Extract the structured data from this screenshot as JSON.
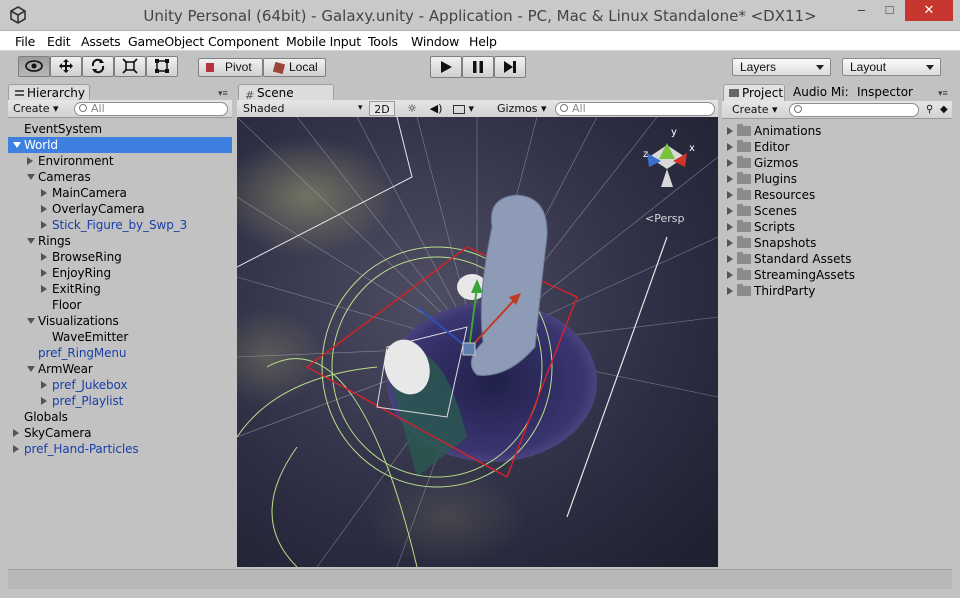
{
  "window": {
    "title": "Unity Personal (64bit) - Galaxy.unity - Application - PC, Mac & Linux Standalone* <DX11>",
    "minimize": "–",
    "maximize": "□",
    "close": "✕",
    "close_color": "#c7372f"
  },
  "menu": [
    "File",
    "Edit",
    "Assets",
    "GameObject",
    "Component",
    "Mobile Input",
    "Tools",
    "Window",
    "Help"
  ],
  "toolbar": {
    "tools": [
      "eye-icon",
      "move-icon",
      "rotate-icon",
      "scale-icon",
      "rect-icon"
    ],
    "pivot_label": "Pivot",
    "local_label": "Local",
    "layers_label": "Layers",
    "layout_label": "Layout"
  },
  "hierarchy": {
    "tab": "Hierarchy",
    "create": "Create",
    "search_placeholder": "All",
    "items": [
      {
        "label": "EventSystem",
        "depth": 0,
        "arrow": "none",
        "prefab": false
      },
      {
        "label": "World",
        "depth": 0,
        "arrow": "open",
        "prefab": false,
        "selected": true
      },
      {
        "label": "Environment",
        "depth": 1,
        "arrow": "closed",
        "prefab": false
      },
      {
        "label": "Cameras",
        "depth": 1,
        "arrow": "open",
        "prefab": false
      },
      {
        "label": "MainCamera",
        "depth": 2,
        "arrow": "closed",
        "prefab": false
      },
      {
        "label": "OverlayCamera",
        "depth": 2,
        "arrow": "closed",
        "prefab": false
      },
      {
        "label": "Stick_Figure_by_Swp_3",
        "depth": 2,
        "arrow": "closed",
        "prefab": true
      },
      {
        "label": "Rings",
        "depth": 1,
        "arrow": "open",
        "prefab": false
      },
      {
        "label": "BrowseRing",
        "depth": 2,
        "arrow": "closed",
        "prefab": false
      },
      {
        "label": "EnjoyRing",
        "depth": 2,
        "arrow": "closed",
        "prefab": false
      },
      {
        "label": "ExitRing",
        "depth": 2,
        "arrow": "closed",
        "prefab": false
      },
      {
        "label": "Floor",
        "depth": 2,
        "arrow": "none",
        "prefab": false
      },
      {
        "label": "Visualizations",
        "depth": 1,
        "arrow": "open",
        "prefab": false
      },
      {
        "label": "WaveEmitter",
        "depth": 2,
        "arrow": "none",
        "prefab": false
      },
      {
        "label": "pref_RingMenu",
        "depth": 1,
        "arrow": "none",
        "prefab": true
      },
      {
        "label": "ArmWear",
        "depth": 1,
        "arrow": "open",
        "prefab": false
      },
      {
        "label": "pref_Jukebox",
        "depth": 2,
        "arrow": "closed",
        "prefab": true
      },
      {
        "label": "pref_Playlist",
        "depth": 2,
        "arrow": "closed",
        "prefab": true
      },
      {
        "label": "Globals",
        "depth": 0,
        "arrow": "none",
        "prefab": false
      },
      {
        "label": "SkyCamera",
        "depth": 0,
        "arrow": "closed",
        "prefab": false
      },
      {
        "label": "pref_Hand-Particles",
        "depth": 0,
        "arrow": "closed",
        "prefab": true
      }
    ]
  },
  "scene": {
    "tab": "Scene",
    "shading": "Shaded",
    "mode_2d": "2D",
    "gizmos": "Gizmos",
    "search_placeholder": "All",
    "persp_label": "Persp",
    "axis_x": "x",
    "axis_y": "y",
    "axis_z": "z"
  },
  "project": {
    "tabs": [
      "Project",
      "Audio Mi:",
      "Inspector"
    ],
    "create": "Create",
    "folders": [
      "Animations",
      "Editor",
      "Gizmos",
      "Plugins",
      "Resources",
      "Scenes",
      "Scripts",
      "Snapshots",
      "Standard Assets",
      "StreamingAssets",
      "ThirdParty"
    ]
  }
}
